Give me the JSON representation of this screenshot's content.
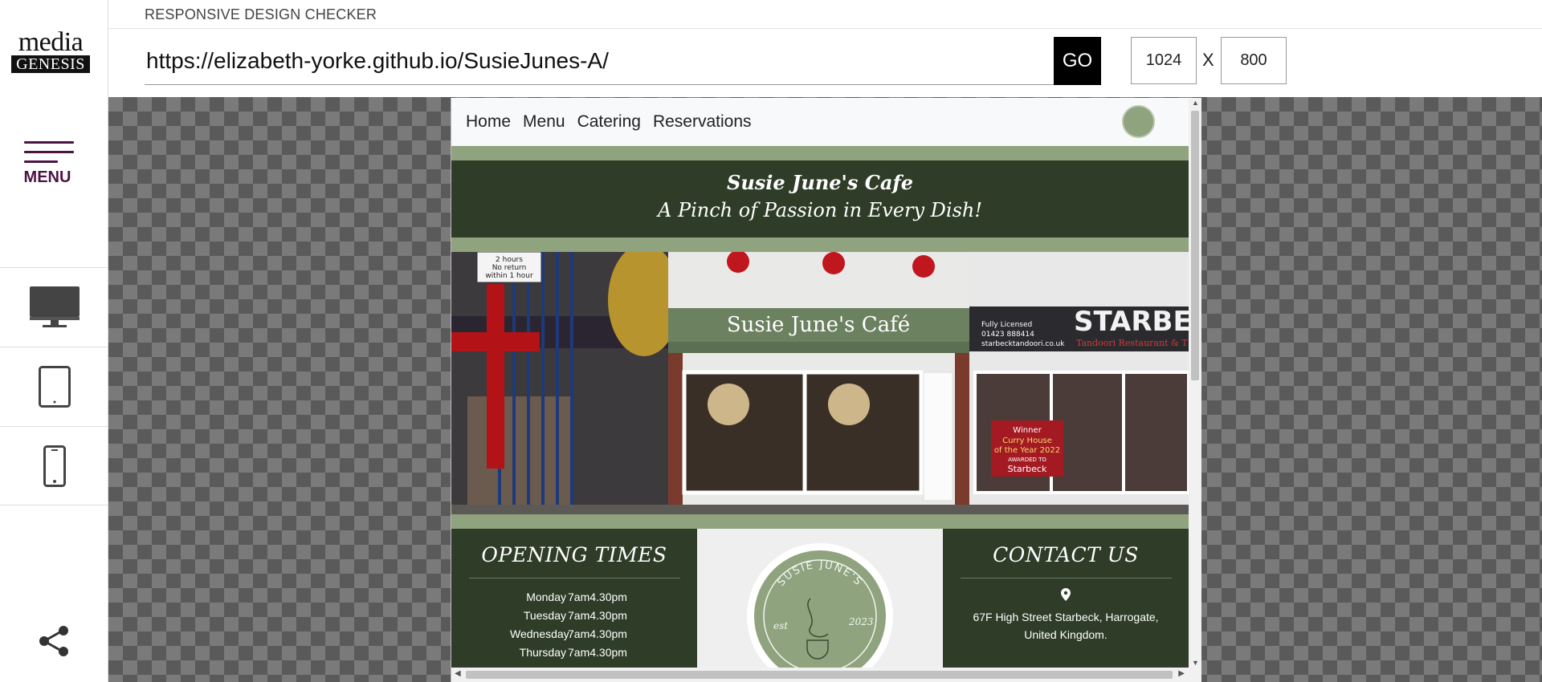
{
  "app": {
    "title": "RESPONSIVE DESIGN CHECKER",
    "logo_top": "media",
    "logo_bottom": "GENESIS",
    "menu_label": "MENU"
  },
  "toolbar": {
    "url": "https://elizabeth-yorke.github.io/SusieJunes-A/",
    "go_label": "GO",
    "width": "1024",
    "height": "800",
    "separator": "X"
  },
  "devices": [
    "desktop-icon",
    "tablet-icon",
    "phone-icon"
  ],
  "site": {
    "nav": [
      "Home",
      "Menu",
      "Catering",
      "Reservations"
    ],
    "header_title": "Susie June's Cafe",
    "header_tagline": "A Pinch of Passion in Every Dish!",
    "photo": {
      "shop_sign": "Susie June's Café",
      "neighbor_sign": "STARBE",
      "neighbor_sub": "Tandoori Restaurant & T",
      "licence": "Fully Licensed",
      "phone": "01423 888414",
      "web": "starbecktandoori.co.uk",
      "parking_1": "2 hours",
      "parking_2": "No return",
      "parking_3": "within 1 hour",
      "award_1": "Winner",
      "award_2": "Curry House",
      "award_3": "of the Year 2022",
      "award_4": "AWARDED TO",
      "award_5": "Starbeck"
    },
    "opening": {
      "title": "OPENING TIMES",
      "rows": [
        {
          "day": "Monday",
          "time": "7am4.30pm"
        },
        {
          "day": "Tuesday",
          "time": "7am4.30pm"
        },
        {
          "day": "Wednesday",
          "time": "7am4.30pm"
        },
        {
          "day": "Thursday",
          "time": "7am4.30pm"
        }
      ]
    },
    "badge": {
      "ring_text": "SUSIE JUNE'S",
      "left": "est",
      "right": "2023"
    },
    "contact": {
      "title": "CONTACT US",
      "address": "67F High Street Starbeck, Harrogate, United Kingdom."
    }
  },
  "colors": {
    "brand_dark": "#2f3d28",
    "brand_sage": "#8ea37e",
    "menu_purple": "#4b1445"
  }
}
